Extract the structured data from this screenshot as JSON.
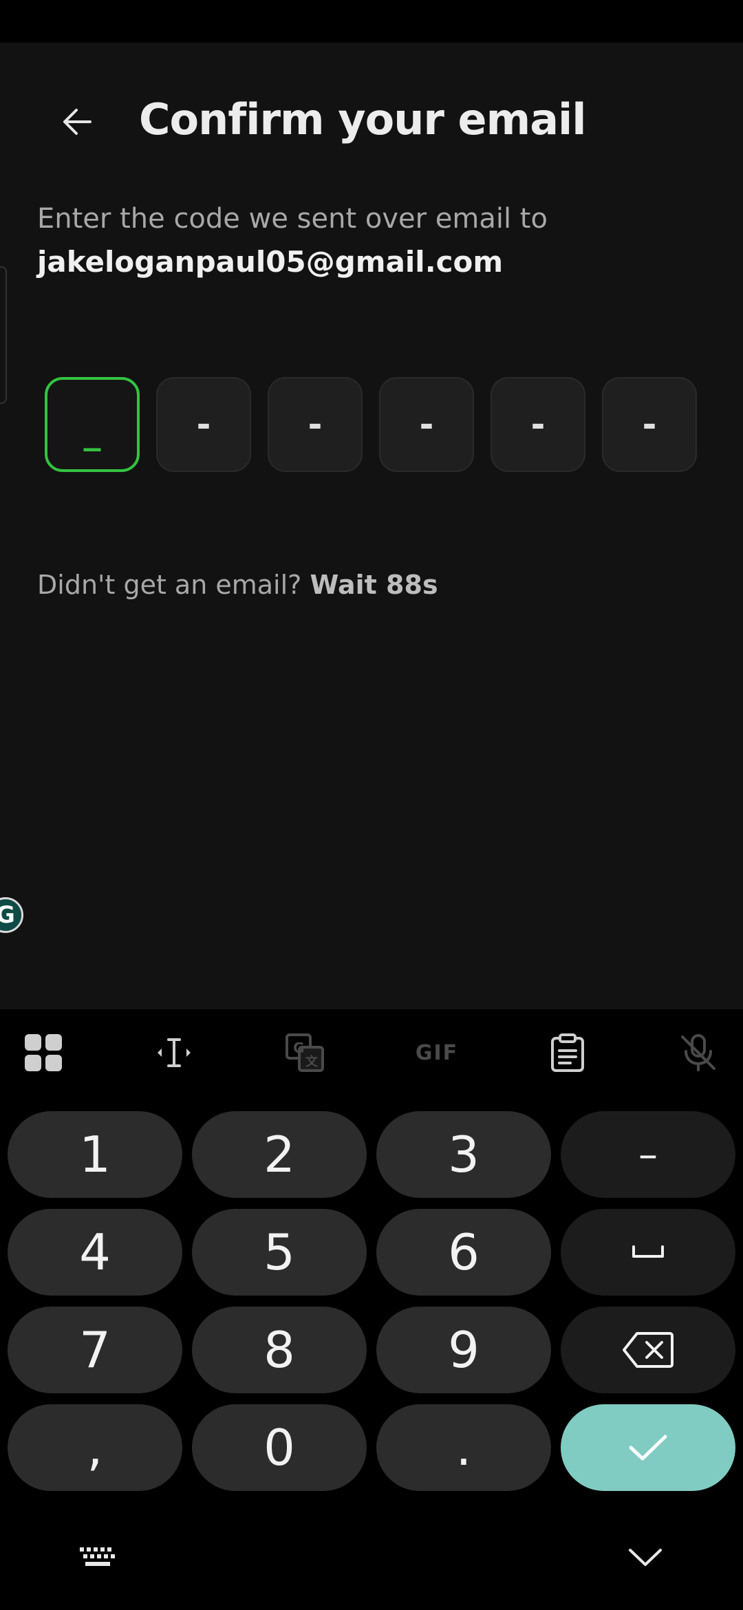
{
  "header": {
    "title": "Confirm your email",
    "back_icon": "arrow-left-icon"
  },
  "prompt": {
    "line1": "Enter the code we sent over email to",
    "email": "jakeloganpaul05@gmail.com"
  },
  "code": {
    "digits": [
      "_",
      "-",
      "-",
      "-",
      "-",
      "-"
    ],
    "active_index": 0,
    "active_color": "#33c33f"
  },
  "resend": {
    "text": "Didn't get an email?",
    "wait": "Wait 88s"
  },
  "keyboard": {
    "toolbar_icons": [
      "apps-grid-icon",
      "text-cursor-icon",
      "translate-icon",
      "gif-icon",
      "clipboard-icon",
      "mic-off-icon"
    ],
    "gif_label": "GIF",
    "keys": {
      "k1": "1",
      "k2": "2",
      "k3": "3",
      "dash": "–",
      "k4": "4",
      "k5": "5",
      "k6": "6",
      "k7": "7",
      "k8": "8",
      "k9": "9",
      "comma": ",",
      "k0": "0",
      "period": "."
    },
    "enter_color": "#80ccc2"
  },
  "colors": {
    "background": "#121212",
    "accent": "#33c33f"
  }
}
